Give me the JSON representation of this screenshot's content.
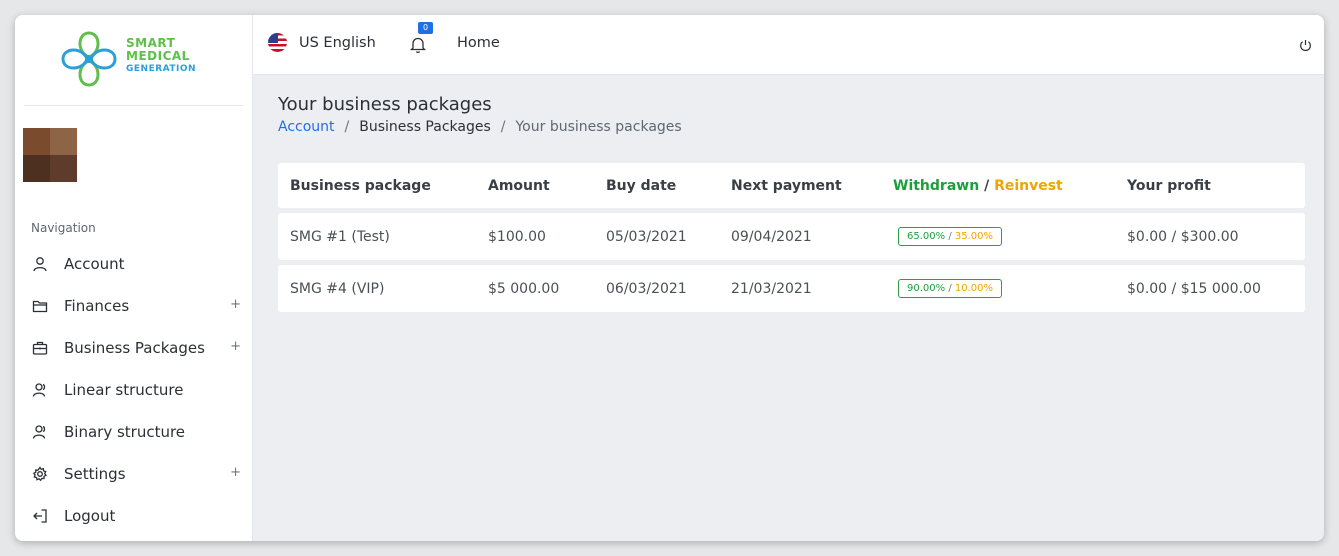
{
  "app": {
    "logo_line1": "SMART",
    "logo_line2": "MEDICAL",
    "logo_line3": "GENERATION"
  },
  "sidebar": {
    "nav_heading": "Navigation",
    "items": [
      {
        "label": "Account",
        "icon": "user-icon",
        "expandable": false
      },
      {
        "label": "Finances",
        "icon": "folder-icon",
        "expandable": true
      },
      {
        "label": "Business Packages",
        "icon": "briefcase-icon",
        "expandable": true
      },
      {
        "label": "Linear structure",
        "icon": "users-icon",
        "expandable": false
      },
      {
        "label": "Binary structure",
        "icon": "users-icon",
        "expandable": false
      },
      {
        "label": "Settings",
        "icon": "gear-icon",
        "expandable": true
      },
      {
        "label": "Logout",
        "icon": "logout-icon",
        "expandable": false
      }
    ],
    "expand_symbol": "+"
  },
  "topbar": {
    "language": "US English",
    "notification_count": "0",
    "home_label": "Home"
  },
  "page": {
    "title": "Your business packages",
    "breadcrumb": {
      "link": "Account",
      "separator": "/",
      "middle": "Business Packages",
      "current": "Your business packages"
    }
  },
  "table": {
    "headers": {
      "package": "Business package",
      "amount": "Amount",
      "buy_date": "Buy date",
      "next_payment": "Next payment",
      "withdrawn": "Withdrawn",
      "slash": "/",
      "reinvest": "Reinvest",
      "profit": "Your profit"
    },
    "rows": [
      {
        "package": "SMG #1 (Test)",
        "amount": "$100.00",
        "buy_date": "05/03/2021",
        "next_payment": "09/04/2021",
        "withdrawn": "65.00%",
        "slash": " / ",
        "reinvest": "35.00%",
        "profit": "$0.00 / $300.00"
      },
      {
        "package": "SMG #4 (VIP)",
        "amount": "$5 000.00",
        "buy_date": "06/03/2021",
        "next_payment": "21/03/2021",
        "withdrawn": "90.00%",
        "slash": " / ",
        "reinvest": "10.00%",
        "profit": "$0.00 / $15 000.00"
      }
    ]
  },
  "colors": {
    "link": "#1f6fe5",
    "withdrawn": "#1e9e3a",
    "reinvest": "#f0a500"
  }
}
